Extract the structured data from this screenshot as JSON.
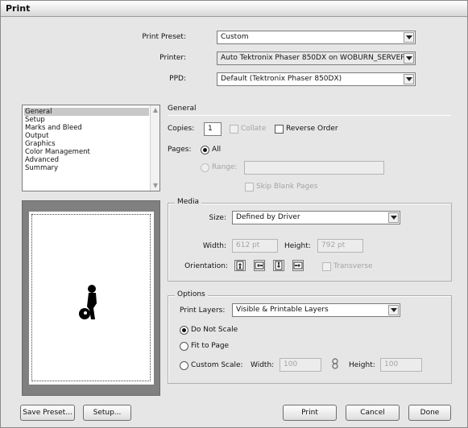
{
  "window": {
    "title": "Print"
  },
  "presets": {
    "print_preset_label": "Print Preset:",
    "print_preset_value": "Custom",
    "printer_label": "Printer:",
    "printer_value": "Auto Tektronix Phaser 850DX on WOBURN_SERVER",
    "ppd_label": "PPD:",
    "ppd_value": "Default (Tektronix Phaser 850DX)"
  },
  "sidebar": {
    "items": [
      "General",
      "Setup",
      "Marks and Bleed",
      "Output",
      "Graphics",
      "Color Management",
      "Advanced",
      "Summary"
    ],
    "selected": "General"
  },
  "general": {
    "section_title": "General",
    "copies_label": "Copies:",
    "copies_value": "1",
    "collate_label": "Collate",
    "reverse_order_label": "Reverse Order",
    "pages_label": "Pages:",
    "all_label": "All",
    "range_label": "Range:",
    "range_value": "",
    "skip_blank_label": "Skip Blank Pages"
  },
  "media": {
    "title": "Media",
    "size_label": "Size:",
    "size_value": "Defined by Driver",
    "width_label": "Width:",
    "width_value": "612 pt",
    "height_label": "Height:",
    "height_value": "792 pt",
    "orientation_label": "Orientation:",
    "transverse_label": "Transverse"
  },
  "options": {
    "title": "Options",
    "print_layers_label": "Print Layers:",
    "print_layers_value": "Visible & Printable Layers",
    "do_not_scale_label": "Do Not Scale",
    "fit_to_page_label": "Fit to Page",
    "custom_scale_label": "Custom Scale:",
    "scale_width_label": "Width:",
    "scale_width_value": "100",
    "scale_height_label": "Height:",
    "scale_height_value": "100",
    "selected_scale": "Do Not Scale"
  },
  "footer": {
    "save_preset_label": "Save Preset...",
    "setup_label": "Setup...",
    "print_label": "Print",
    "cancel_label": "Cancel",
    "done_label": "Done"
  }
}
